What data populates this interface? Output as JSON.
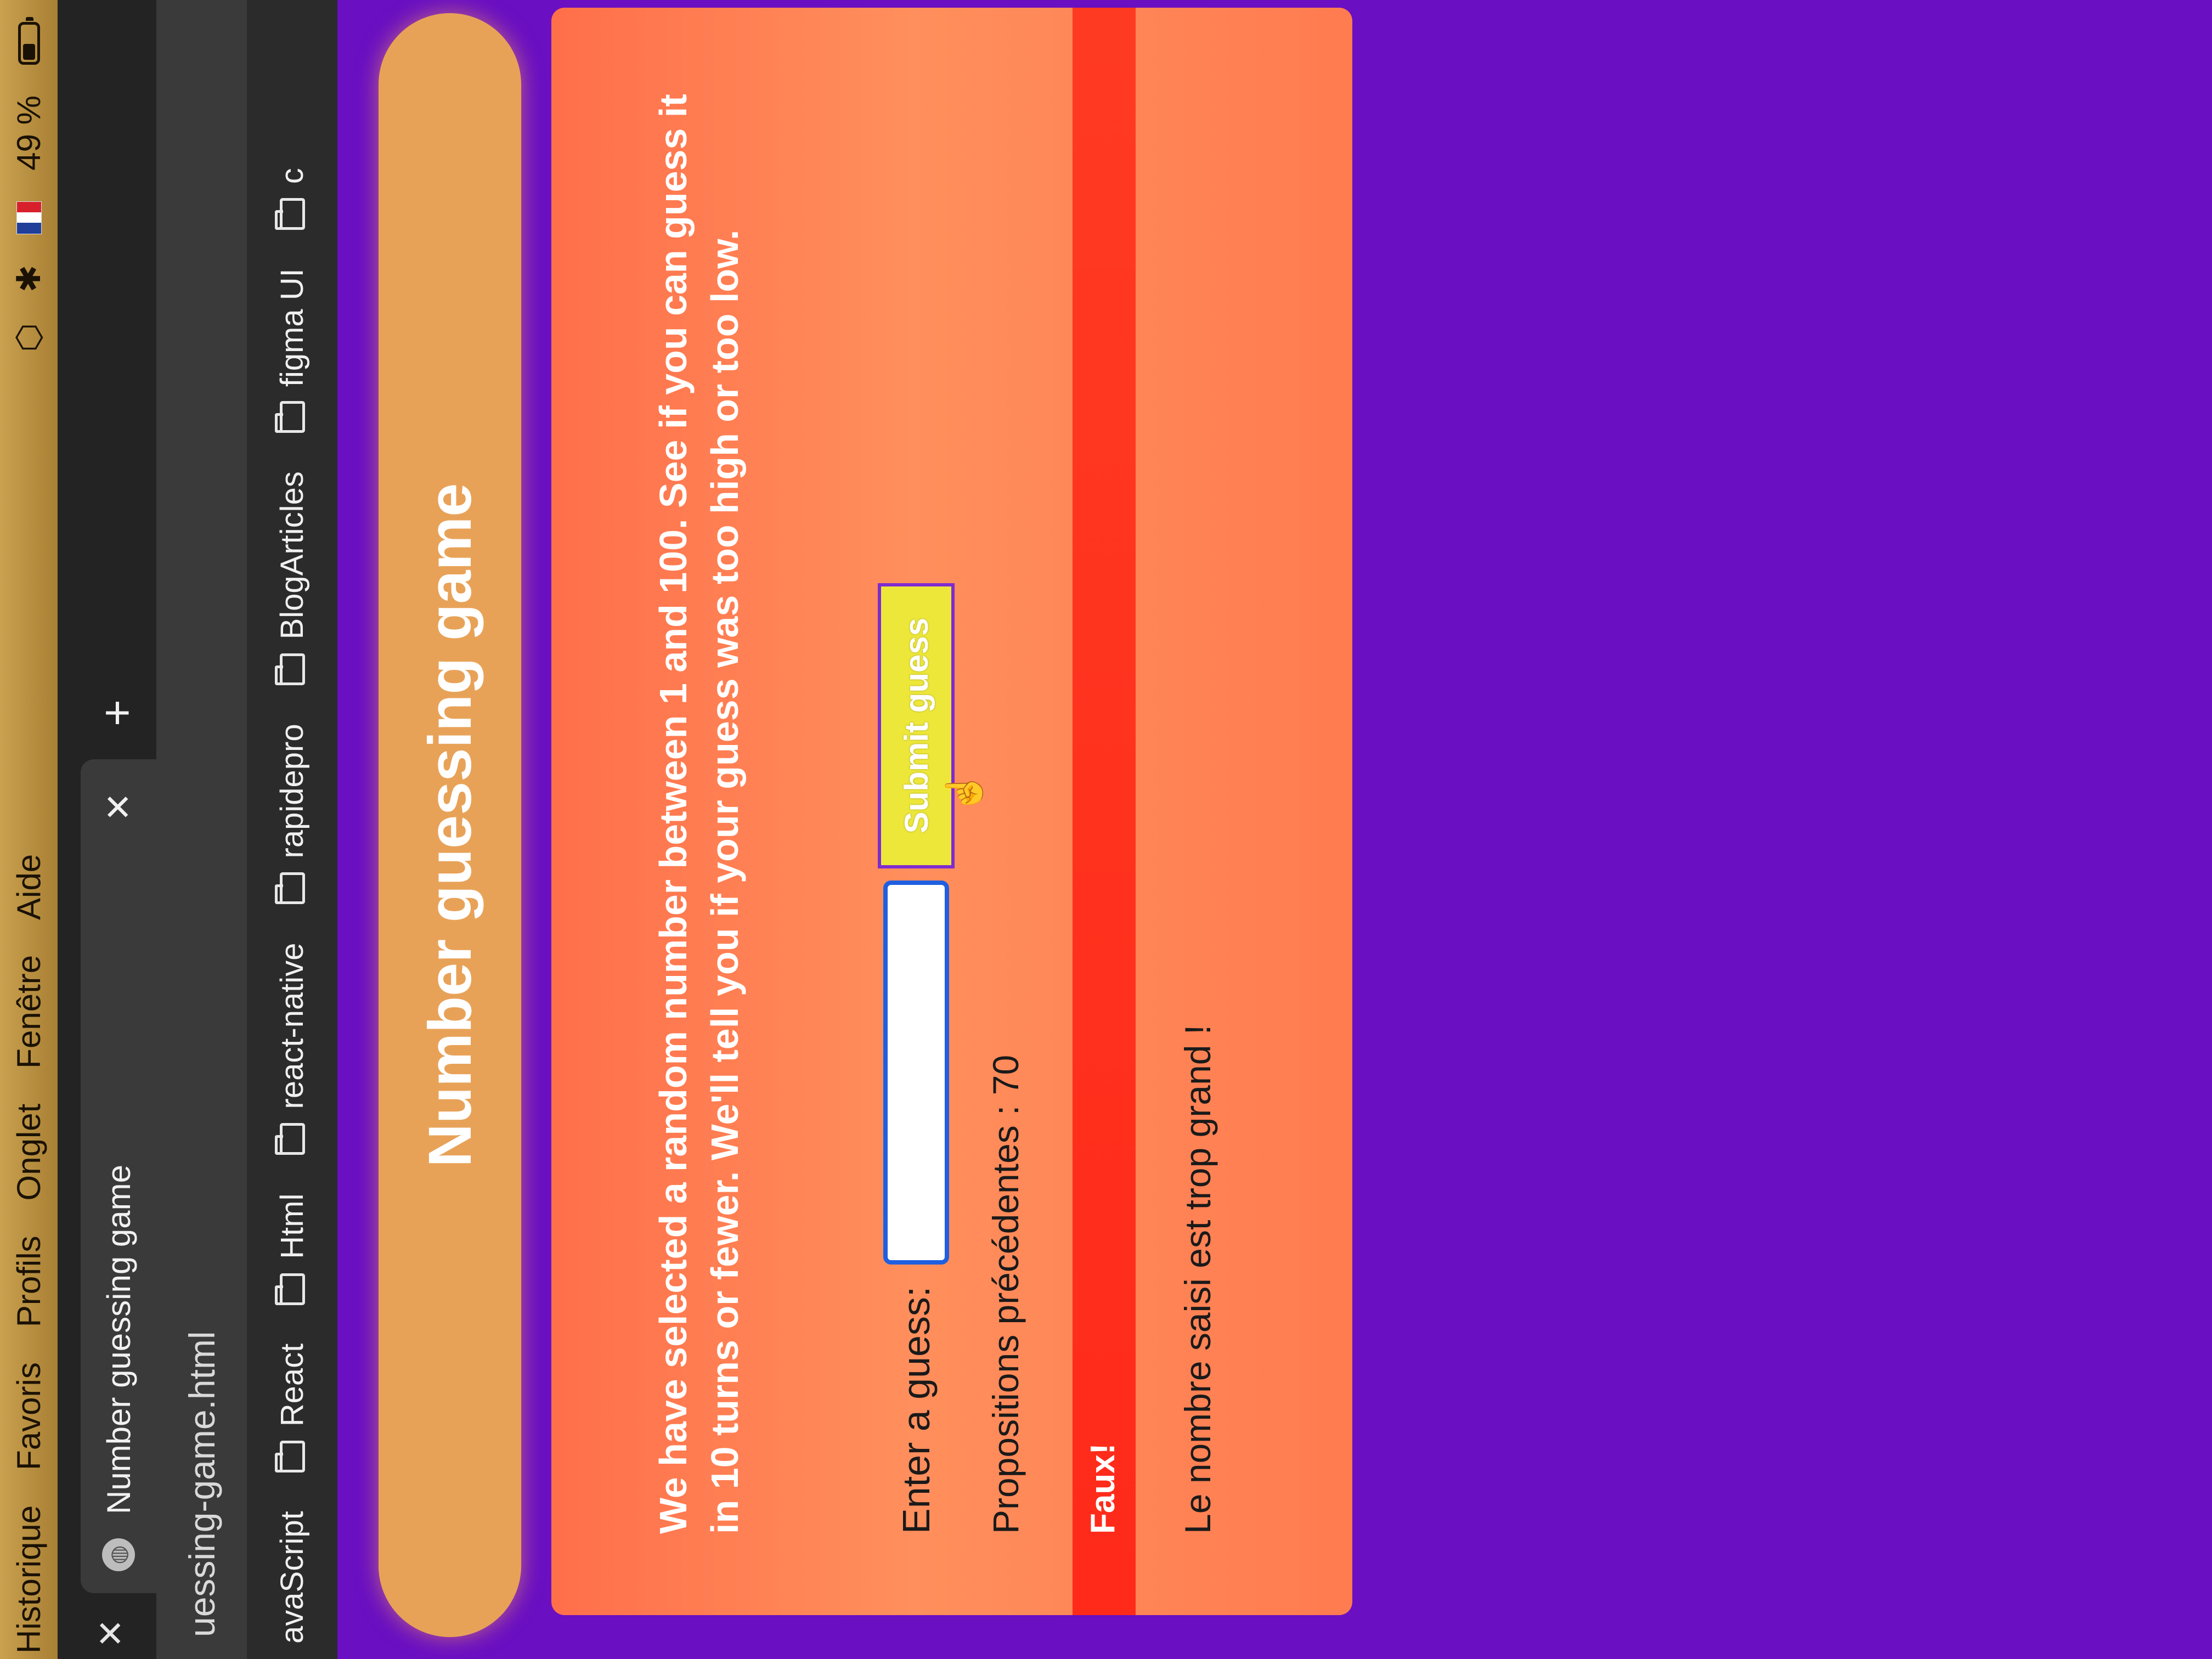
{
  "menubar": {
    "items": [
      "Historique",
      "Favoris",
      "Profils",
      "Onglet",
      "Fenêtre",
      "Aide"
    ],
    "battery": "49 %",
    "battery_level": 0.49
  },
  "browser": {
    "tab_title": "Number guessing game",
    "url": "uessing-game.html",
    "bookmarks": [
      "avaScript",
      "React",
      "Html",
      "react-native",
      "rapidepro",
      "BlogArticles",
      "figma UI",
      "c"
    ]
  },
  "page": {
    "heading": "Number guessing game",
    "intro": "We have selected a random number between 1 and 100. See if you can guess it in 10 turns or fewer. We'll tell you if your guess was too high or too low.",
    "guess_label": "Enter a guess:",
    "guess_value": "",
    "submit_label": "Submit guess",
    "previous_guesses": "Propositions précédentes : 70",
    "last_result": "Faux!",
    "low_or_hi": "Le nombre saisi est trop grand !"
  },
  "colors": {
    "background": "#6a0fc2",
    "card": "#ff7b50",
    "heading_bar": "#e8a258",
    "result_bar": "#ff2a1a",
    "submit_button": "#ede73a"
  }
}
